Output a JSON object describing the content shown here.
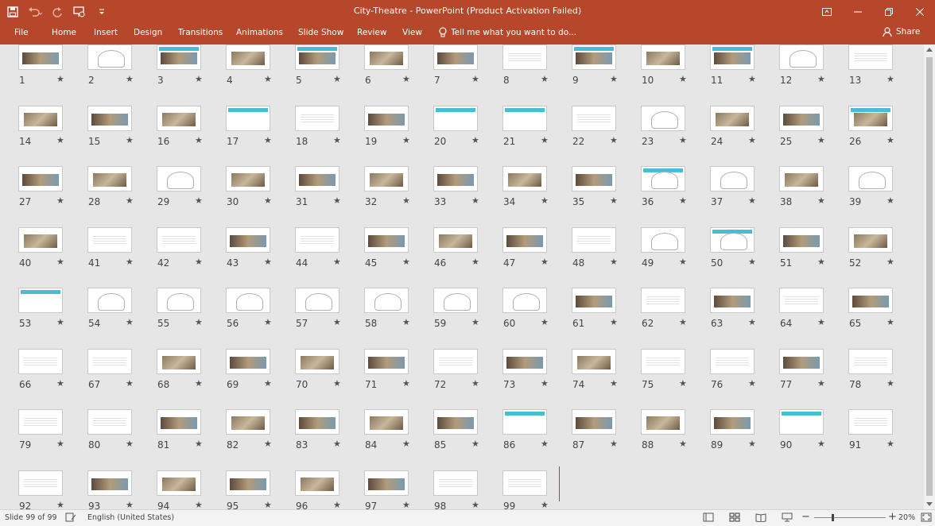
{
  "window": {
    "title": "City-Theatre - PowerPoint (Product Activation Failed)"
  },
  "ribbon": {
    "tabs": [
      "File",
      "Home",
      "Insert",
      "Design",
      "Transitions",
      "Animations",
      "Slide Show",
      "Review",
      "View"
    ],
    "tell_me": "Tell me what you want to do...",
    "share": "Share"
  },
  "sorter": {
    "slide_count": 99,
    "star_glyph": "★",
    "thumbnails": [
      "title-photo",
      "drawing",
      "banner-photo",
      "photo",
      "banner-photo",
      "photo",
      "photo",
      "text",
      "banner-photo",
      "photo",
      "banner-photo",
      "map",
      "text",
      "photo",
      "photo",
      "photo",
      "banner",
      "text",
      "photo",
      "banner",
      "banner",
      "text",
      "drawing",
      "photo",
      "photo",
      "banner-photo",
      "photo",
      "photo",
      "drawing",
      "photo",
      "photo",
      "photo",
      "photo",
      "photo",
      "photo",
      "banner-drawing",
      "drawing",
      "photo",
      "drawing",
      "photo",
      "text",
      "text",
      "photo",
      "text",
      "photo",
      "photo",
      "photo",
      "text",
      "drawing",
      "banner-drawing",
      "photo",
      "photo",
      "banner",
      "drawing",
      "drawing",
      "drawing",
      "drawing",
      "drawing",
      "drawing",
      "drawing",
      "photo",
      "text",
      "photo",
      "text",
      "photo",
      "text",
      "text",
      "photo",
      "photo",
      "photo",
      "photo",
      "text",
      "photo",
      "photo",
      "text",
      "text",
      "photo",
      "text",
      "text",
      "text",
      "photo",
      "photo",
      "photo",
      "photo",
      "photo",
      "banner",
      "photo",
      "photo",
      "photo",
      "banner",
      "text",
      "text",
      "photo",
      "photo",
      "photo",
      "photo",
      "photo",
      "text",
      "text"
    ]
  },
  "statusbar": {
    "slide_info": "Slide 99 of 99",
    "language": "English (United States)",
    "zoom": "20%"
  }
}
